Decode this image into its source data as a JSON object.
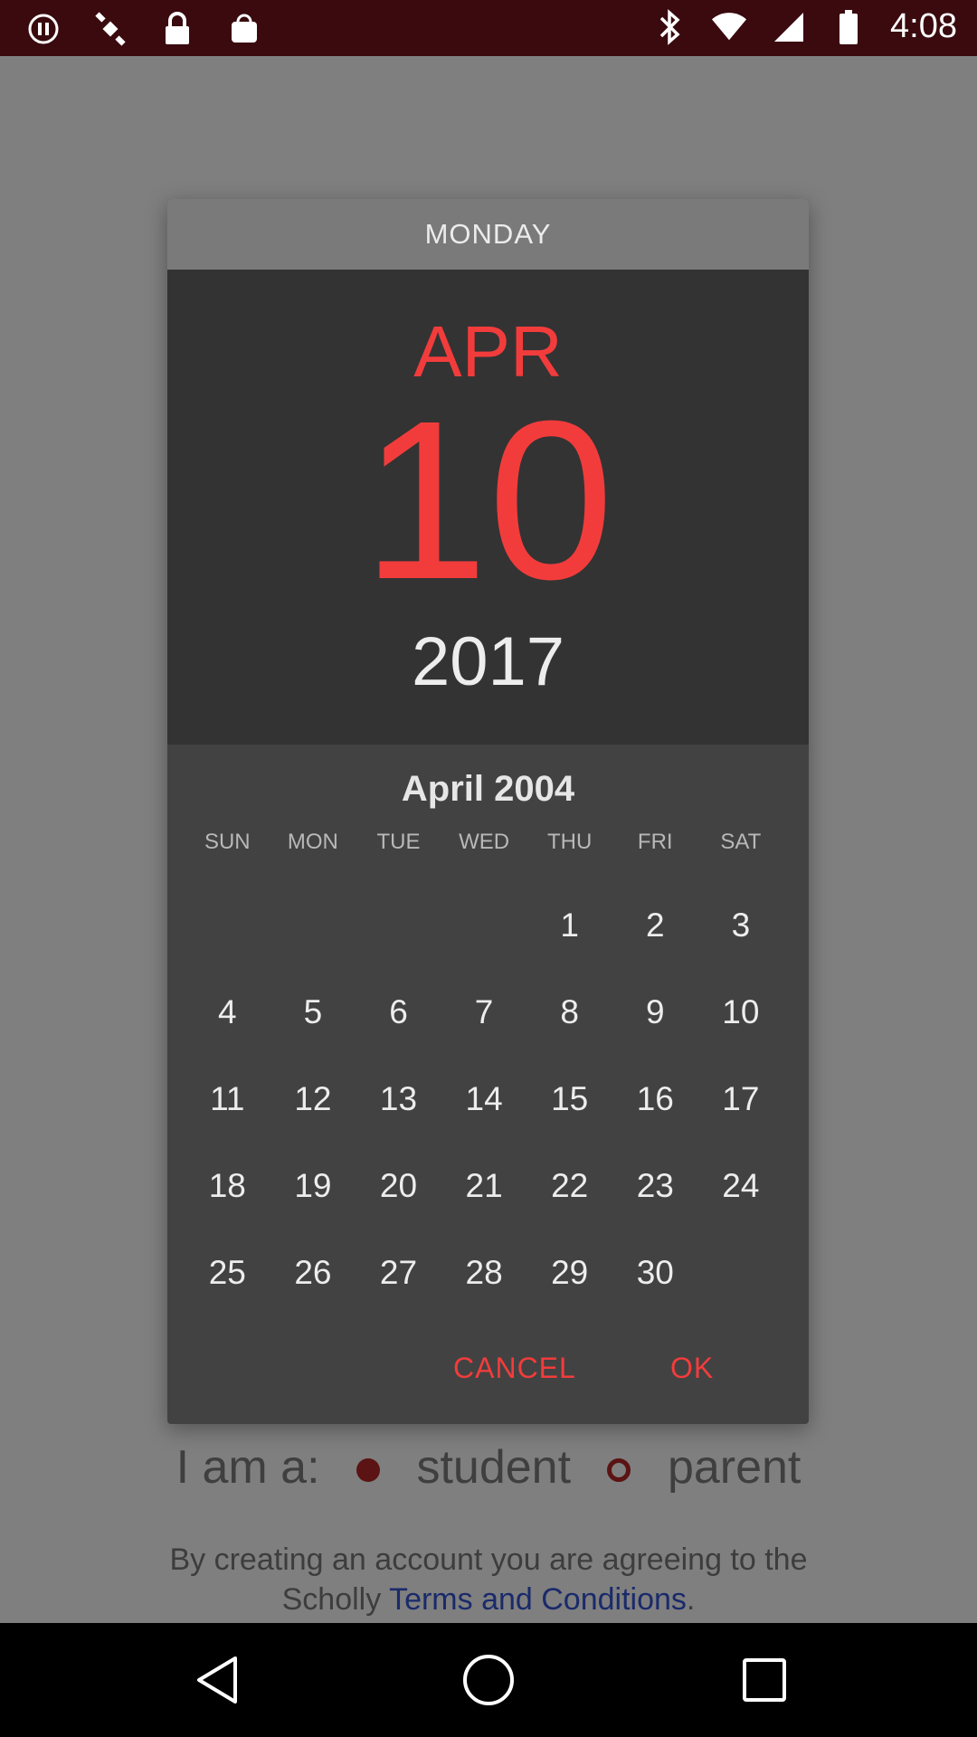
{
  "status_bar": {
    "time": "4:08",
    "left_icons": [
      "pause-circle-icon",
      "fake-gps-icon",
      "lock-icon",
      "bag-icon"
    ],
    "right_icons": [
      "bluetooth-icon",
      "wifi-icon",
      "signal-icon",
      "battery-icon"
    ]
  },
  "background": {
    "role_prompt": "I am a:",
    "role_option_1": "student",
    "role_option_2": "parent",
    "terms_text": "By creating an account you are agreeing to the",
    "terms_prefix": "Scholly",
    "terms_link": "Terms and Conditions",
    "terms_suffix": "."
  },
  "dialog": {
    "day_name": "MONDAY",
    "month": "APR",
    "day": "10",
    "year": "2017",
    "calendar_title": "April 2004",
    "weekdays": [
      "SUN",
      "MON",
      "TUE",
      "WED",
      "THU",
      "FRI",
      "SAT"
    ],
    "first_weekday_index": 4,
    "days": [
      "1",
      "2",
      "3",
      "4",
      "5",
      "6",
      "7",
      "8",
      "9",
      "10",
      "11",
      "12",
      "13",
      "14",
      "15",
      "16",
      "17",
      "18",
      "19",
      "20",
      "21",
      "22",
      "23",
      "24",
      "25",
      "26",
      "27",
      "28",
      "29",
      "30"
    ],
    "cancel_label": "CANCEL",
    "ok_label": "OK"
  },
  "colors": {
    "accent": "#f23c3c",
    "status_bar": "#3a0a0f",
    "dialog_bg": "#424242",
    "header_bg": "#333333"
  },
  "nav_bar": {
    "icons": [
      "back-icon",
      "home-icon",
      "recents-icon"
    ]
  }
}
